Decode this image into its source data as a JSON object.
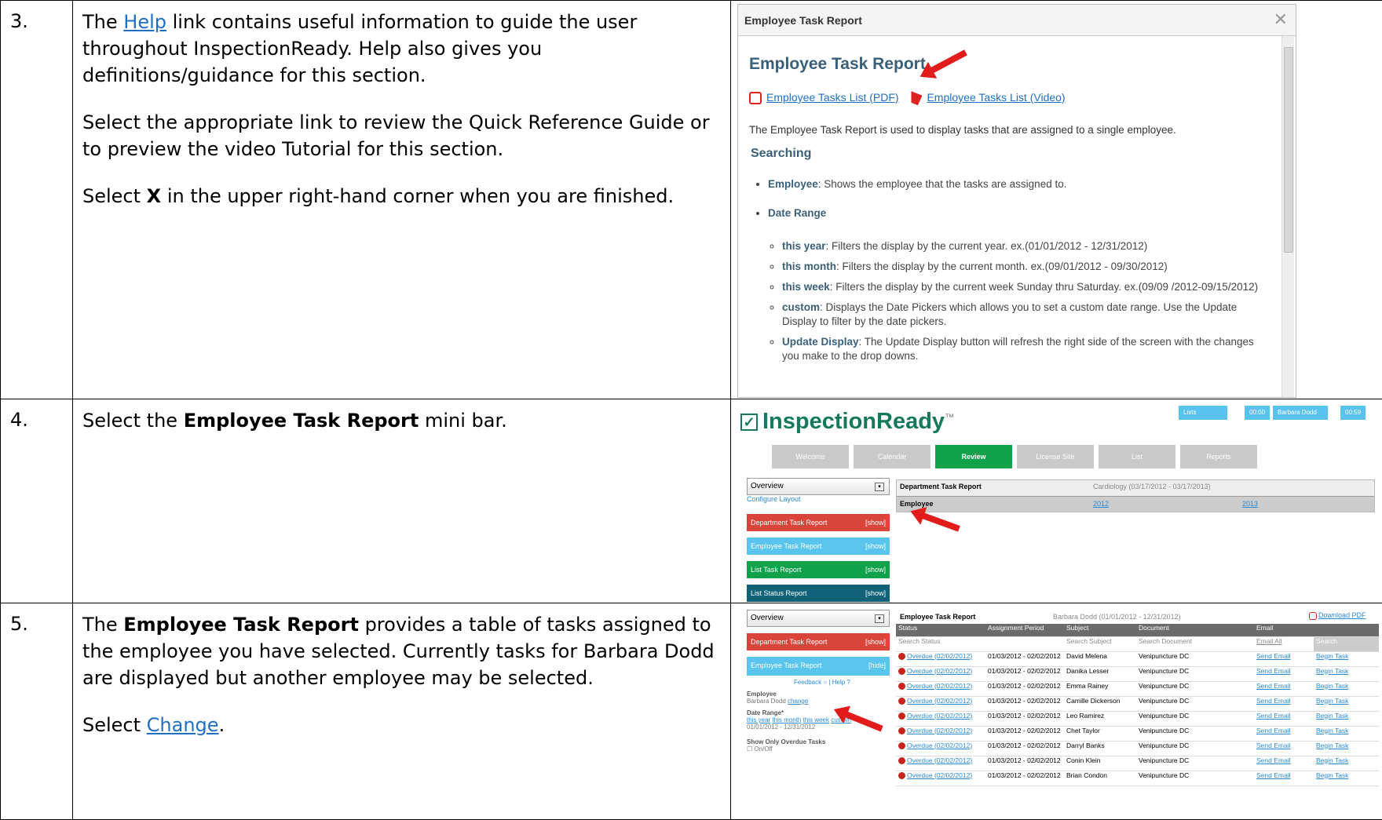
{
  "steps": [
    {
      "num": "3.",
      "p1a": "The ",
      "p1link": "Help",
      "p1b": " link contains useful information to guide the user throughout InspectionReady.  Help also gives you definitions/guidance for this section.",
      "p2": "Select the appropriate link to review the Quick Reference Guide or to preview the video Tutorial for this section.",
      "p3a": "Select ",
      "p3b": "X",
      "p3c": " in the upper right-hand corner when you are finished."
    },
    {
      "num": "4.",
      "p1a": "Select the ",
      "p1b": "Employee Task Report",
      "p1c": " mini bar."
    },
    {
      "num": "5.",
      "p1a": "The ",
      "p1b": "Employee Task Report",
      "p1c": " provides a table of tasks assigned to the employee you have selected.  Currently tasks for Barbara Dodd are displayed but another employee may be selected.",
      "p2a": "Select ",
      "p2link": "Change",
      "p2b": "."
    }
  ],
  "help": {
    "window_title": "Employee Task Report",
    "close": "✕",
    "heading": "Employee Task Report",
    "pdf_link": "Employee Tasks List (PDF)",
    "video_link": "Employee Tasks List (Video)",
    "desc": "The Employee Task Report is used to display tasks that are assigned to a single employee.",
    "searching": "Searching",
    "employee_k": "Employee",
    "employee_v": ": Shows the employee that the tasks are assigned to.",
    "date_range": "Date Range",
    "items": [
      {
        "k": "this year",
        "v": ": Filters the display by the current year. ex.(01/01/2012 - 12/31/2012)"
      },
      {
        "k": "this month",
        "v": ": Filters the display by the current month. ex.(09/01/2012 - 09/30/2012)"
      },
      {
        "k": "this week",
        "v": ": Filters the display by the current week Sunday thru Saturday. ex.(09/09 /2012-09/15/2012)"
      },
      {
        "k": "custom",
        "v": ": Displays the Date Pickers which allows you to set a custom date range. Use the Update Display to filter by the date pickers."
      },
      {
        "k": "Update Display",
        "v": ": The Update Display button will refresh the right side of the screen with the changes you make to the drop downs."
      }
    ]
  },
  "app4": {
    "logo": "InspectionReady",
    "tm": "™",
    "top_lists": "Lists",
    "time1": "00:00",
    "user": "Barbara Dodd",
    "time2": "00:59",
    "tabs": [
      "Welcome",
      "Calendar",
      "Review",
      "License Site",
      "List",
      "Reports"
    ],
    "select": "Overview",
    "configure": "Configure Layout",
    "bars": [
      "Department Task Report",
      "Employee Task Report",
      "List Task Report",
      "List Status Report"
    ],
    "show": "[show]",
    "report_title": "Department Task Report",
    "report_scope": "Cardiology (03/17/2012 - 03/17/2013)",
    "col_employee": "Employee",
    "col_2012": "2012",
    "col_2013": "2013"
  },
  "app5": {
    "select": "Overview",
    "bar_dept": "Department Task Report",
    "show": "[show]",
    "bar_emp": "Employee Task Report",
    "hide": "[hide]",
    "feedback": "Feedback",
    "help": "Help",
    "employee_label": "Employee",
    "employee_name": "Barbara Dodd",
    "change": "change",
    "date_range_label": "Date Range*",
    "ranges": [
      "this year",
      "this month",
      "this week",
      "custom"
    ],
    "range_value": "01/01/2012 - 12/31/2012",
    "overdue_label": "Show Only Overdue Tasks",
    "onoff": "On/Off",
    "report_title": "Employee Task Report",
    "report_scope": "Barbara Dodd (01/01/2012 - 12/31/2012)",
    "download": "Download PDF",
    "headers": [
      "Status",
      "Assignment Period",
      "Subject",
      "Document",
      "Email",
      ""
    ],
    "search": [
      "Search Status",
      "",
      "Search Subject",
      "Search Document",
      "Email All",
      "Search"
    ],
    "rows": [
      {
        "status": "Overdue (02/02/2012)",
        "period": "01/03/2012 - 02/02/2012",
        "subject": "David Melena",
        "doc": "Venipuncture DC",
        "email": "Send Email",
        "task": "Begin Task"
      },
      {
        "status": "Overdue (02/02/2012)",
        "period": "01/03/2012 - 02/02/2012",
        "subject": "Danika Lesser",
        "doc": "Venipuncture DC",
        "email": "Send Email",
        "task": "Begin Task"
      },
      {
        "status": "Overdue (02/02/2012)",
        "period": "01/03/2012 - 02/02/2012",
        "subject": "Emma Rainey",
        "doc": "Venipuncture DC",
        "email": "Send Email",
        "task": "Begin Task"
      },
      {
        "status": "Overdue (02/02/2012)",
        "period": "01/03/2012 - 02/02/2012",
        "subject": "Camille Dickerson",
        "doc": "Venipuncture DC",
        "email": "Send Email",
        "task": "Begin Task"
      },
      {
        "status": "Overdue (02/02/2012)",
        "period": "01/03/2012 - 02/02/2012",
        "subject": "Leo Ramirez",
        "doc": "Venipuncture DC",
        "email": "Send Email",
        "task": "Begin Task"
      },
      {
        "status": "Overdue (02/02/2012)",
        "period": "01/03/2012 - 02/02/2012",
        "subject": "Chet Taylor",
        "doc": "Venipuncture DC",
        "email": "Send Email",
        "task": "Begin Task"
      },
      {
        "status": "Overdue (02/02/2012)",
        "period": "01/03/2012 - 02/02/2012",
        "subject": "Darryl Banks",
        "doc": "Venipuncture DC",
        "email": "Send Email",
        "task": "Begin Task"
      },
      {
        "status": "Overdue (02/02/2012)",
        "period": "01/03/2012 - 02/02/2012",
        "subject": "Conin Klein",
        "doc": "Venipuncture DC",
        "email": "Send Email",
        "task": "Begin Task"
      },
      {
        "status": "Overdue (02/02/2012)",
        "period": "01/03/2012 - 02/02/2012",
        "subject": "Brian Condon",
        "doc": "Venipuncture DC",
        "email": "Send Email",
        "task": "Begin Task"
      }
    ]
  }
}
